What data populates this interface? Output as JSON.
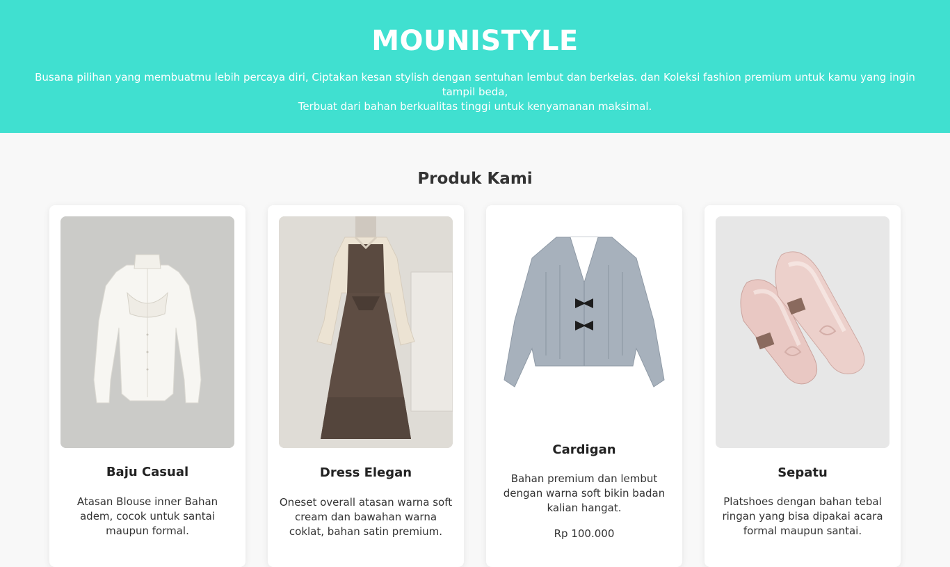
{
  "header": {
    "brand": "MOUNISTYLE",
    "tagline_line1": "Busana pilihan yang membuatmu lebih percaya diri, Ciptakan kesan stylish dengan sentuhan lembut dan berkelas. dan Koleksi fashion premium untuk kamu yang ingin tampil beda,",
    "tagline_line2": "Terbuat dari bahan berkualitas tinggi untuk kenyamanan maksimal."
  },
  "section": {
    "title": "Produk Kami"
  },
  "products": [
    {
      "name": "Baju Casual",
      "description": "Atasan Blouse inner Bahan adem, cocok untuk santai maupun formal.",
      "image_icon": "white-blouse-image"
    },
    {
      "name": "Dress Elegan",
      "description": "Oneset overall atasan warna soft cream dan bawahan warna coklat, bahan satin premium.",
      "image_icon": "brown-overall-dress-image"
    },
    {
      "name": "Cardigan",
      "description": "Bahan premium dan lembut dengan warna soft bikin badan kalian hangat.",
      "price": "Rp 100.000",
      "image_icon": "grey-cardigan-image"
    },
    {
      "name": "Sepatu",
      "description": "Platshoes dengan bahan tebal ringan yang bisa dipakai acara formal maupun santai.",
      "image_icon": "pink-flat-shoes-image"
    }
  ],
  "colors": {
    "header_bg": "#40e0d0",
    "page_bg": "#f8f8f8",
    "card_bg": "#ffffff"
  }
}
